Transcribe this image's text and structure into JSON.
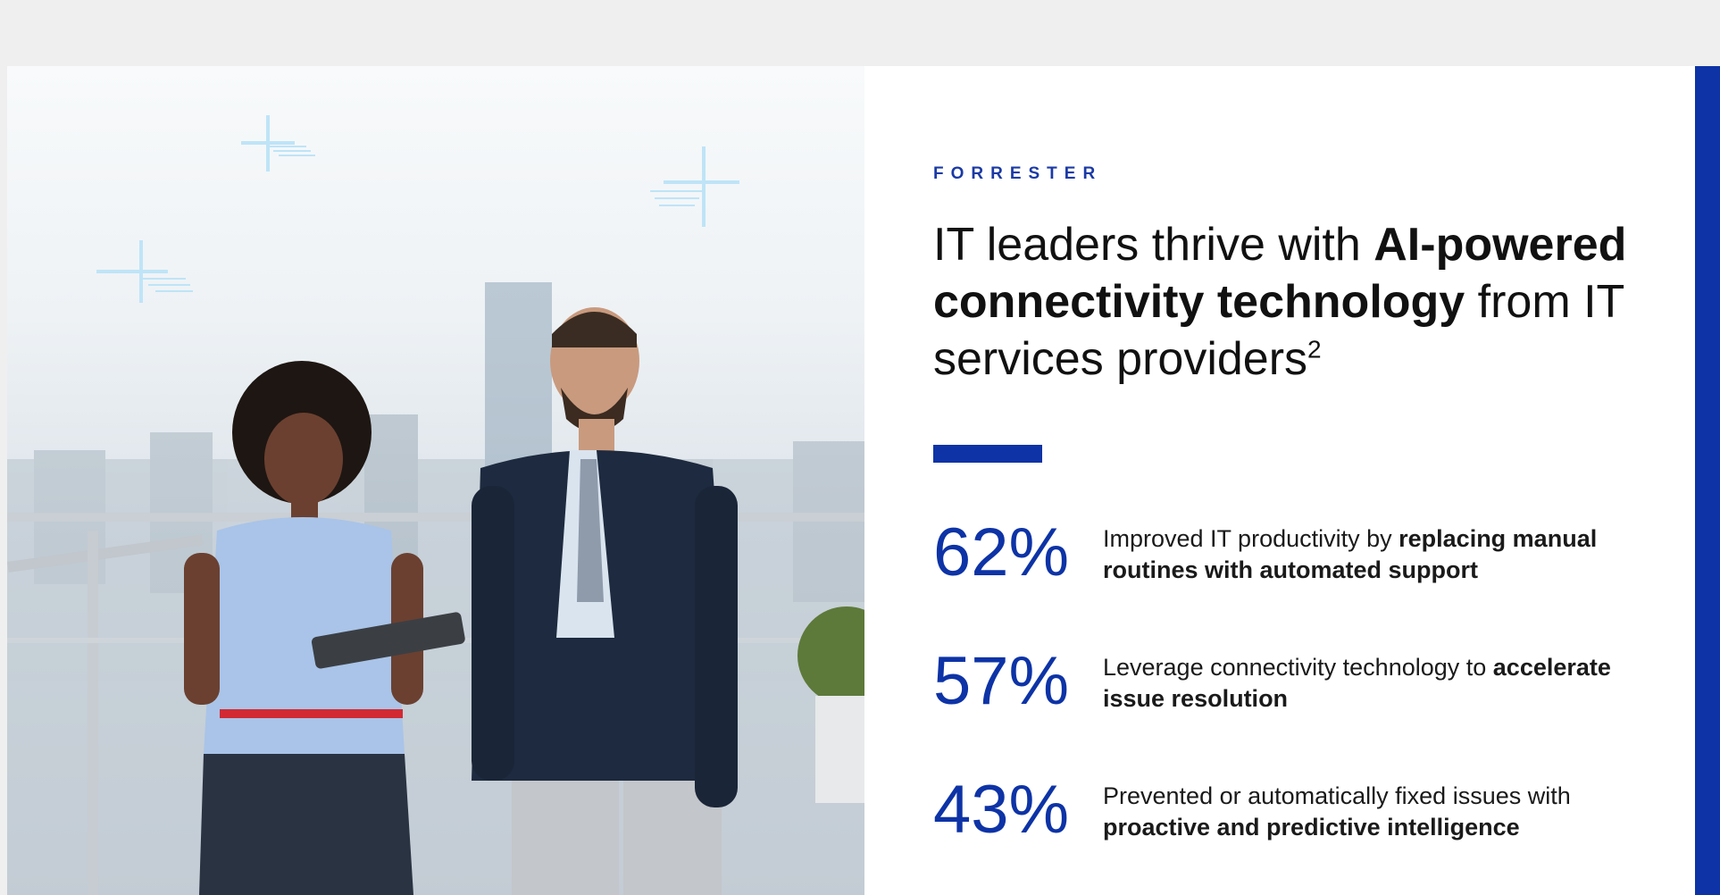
{
  "brand": "FORRESTER",
  "headline": {
    "part1": "IT leaders thrive with ",
    "bold": "AI-powered connectivity technology",
    "part2": " from IT services providers",
    "footnote": "2"
  },
  "stats": [
    {
      "value": "62%",
      "text": "Improved IT productivity by ",
      "bold": "replacing manual routines with automated support"
    },
    {
      "value": "57%",
      "text": "Leverage connectivity technology to ",
      "bold": "accelerate issue resolution"
    },
    {
      "value": "43%",
      "text": "Prevented or automatically fixed issues with ",
      "bold": "proactive and predictive intelligence"
    }
  ],
  "colors": {
    "accent": "#0d33a6",
    "brand_text": "#1b3aa5",
    "page_bg": "#efefef"
  },
  "icons": [
    "sparkle-icon",
    "sparkle-icon",
    "sparkle-icon"
  ]
}
